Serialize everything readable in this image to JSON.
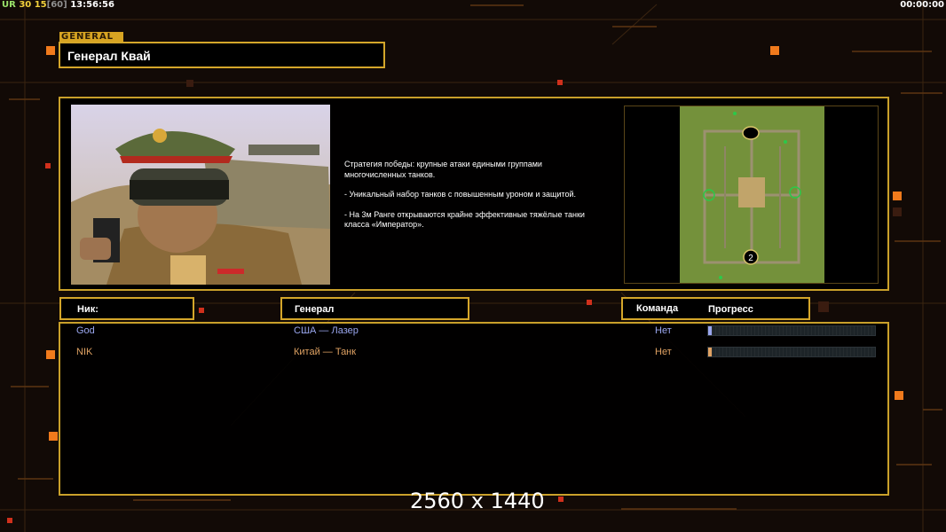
{
  "status_bar": {
    "ur_label": "UR",
    "fps": "30",
    "logic_fps": "15",
    "logic_cap": "[60]",
    "clock": "13:56:56",
    "game_time": "00:00:00"
  },
  "general": {
    "tab_label": "GENERAL",
    "name": "Генерал Квай",
    "description": [
      "Стратегия победы: крупные атаки едиными группами\n многочисленных танков.",
      "- Уникальный набор танков с повышенным уроном и защитой.",
      "- На 3м Ранге открываются крайне эффективные тяжёлые танки\n класса «Император»."
    ]
  },
  "map": {
    "player_marker": "2"
  },
  "players_table": {
    "headers": {
      "nick": "Ник:",
      "general": "Генерал",
      "team": "Команда",
      "progress": "Прогресс"
    },
    "rows": [
      {
        "nick": "God",
        "general": "США — Лазер",
        "team": "Нет",
        "progress": 0.02,
        "color": "#9aa6ee"
      },
      {
        "nick": "NIK",
        "general": "Китай — Танк",
        "team": "Нет",
        "progress": 0.02,
        "color": "#e0a263"
      }
    ]
  },
  "resolution_label": "2560 x 1440",
  "colors": {
    "accent": "#d4a62a",
    "background": "#120a06",
    "player1": "#9aa6ee",
    "player2": "#e0a263"
  }
}
